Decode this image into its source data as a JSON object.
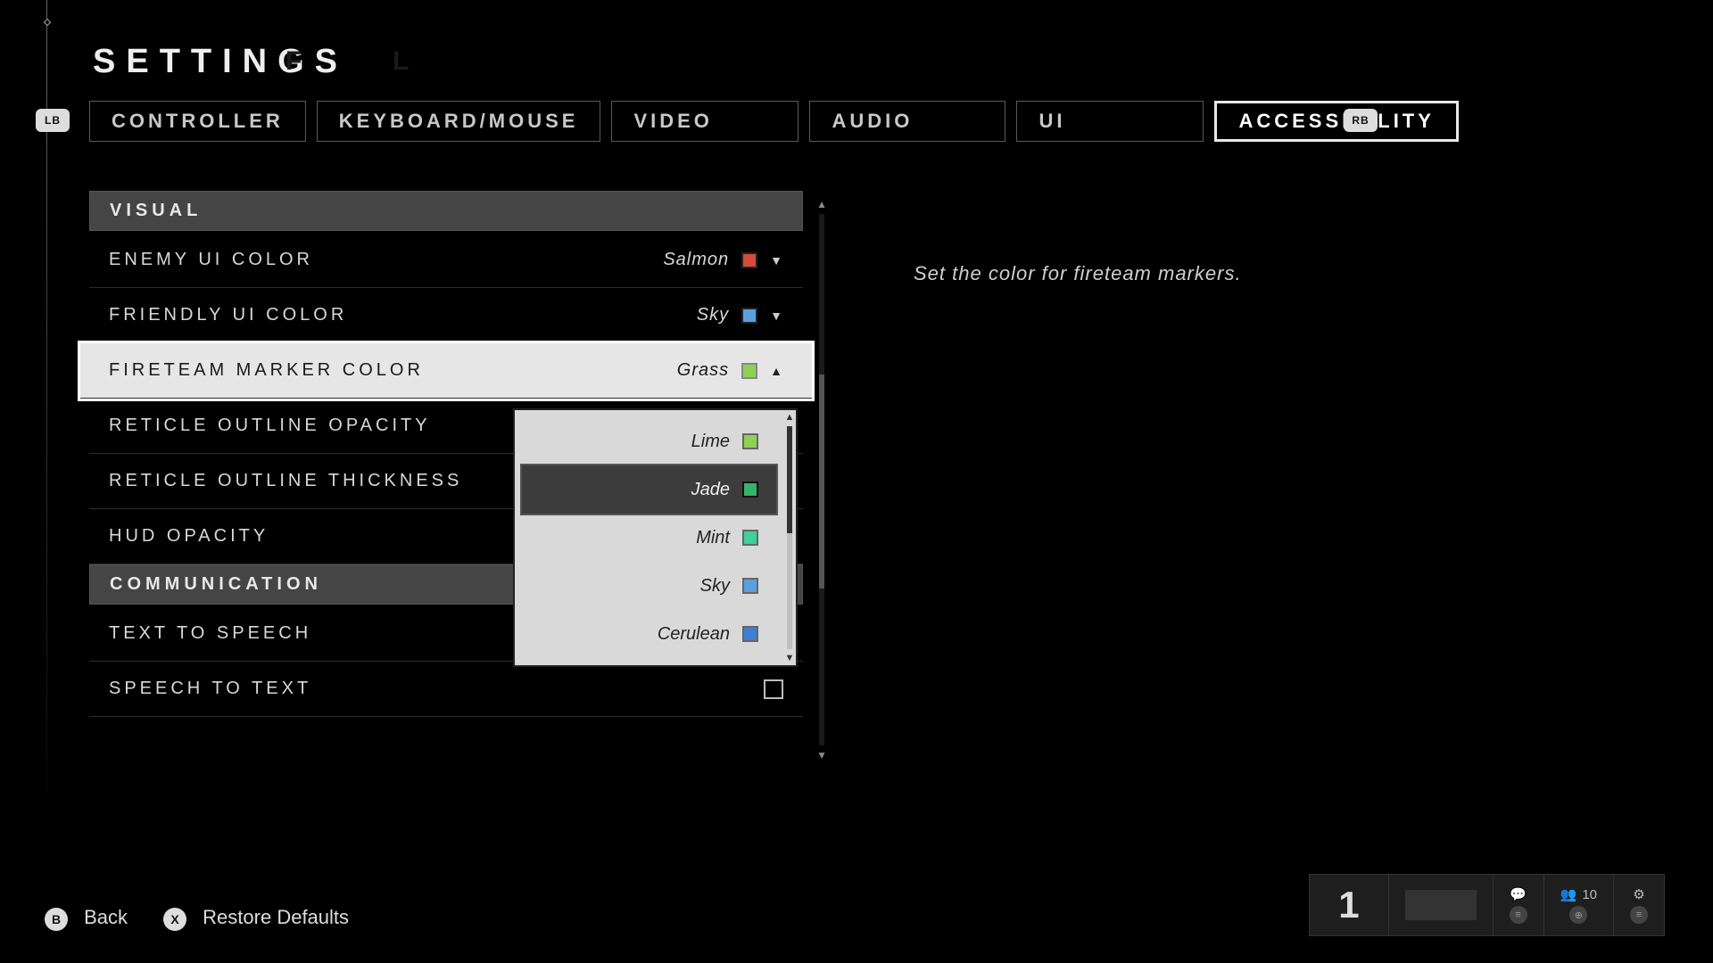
{
  "title": "SETTINGS",
  "tabs": [
    "CONTROLLER",
    "KEYBOARD/MOUSE",
    "VIDEO",
    "AUDIO",
    "UI",
    "ACCESSIBILITY"
  ],
  "active_tab_index": 5,
  "bumpers": {
    "left": "LB",
    "right": "RB"
  },
  "sections": {
    "visual_head": "VISUAL",
    "comm_head": "COMMUNICATION"
  },
  "rows": {
    "enemy": {
      "label": "ENEMY UI COLOR",
      "value": "Salmon",
      "swatch": "#d84a3a"
    },
    "friendly": {
      "label": "FRIENDLY UI COLOR",
      "value": "Sky",
      "swatch": "#5aa0e0"
    },
    "fireteam": {
      "label": "FIRETEAM MARKER COLOR",
      "value": "Grass",
      "swatch": "#8fd154"
    },
    "retopacity": {
      "label": "RETICLE OUTLINE OPACITY"
    },
    "retthick": {
      "label": "RETICLE OUTLINE THICKNESS"
    },
    "hud": {
      "label": "HUD OPACITY"
    },
    "tts": {
      "label": "TEXT TO SPEECH"
    },
    "stt": {
      "label": "SPEECH TO TEXT"
    }
  },
  "dropdown": {
    "items": [
      {
        "label": "Lime",
        "swatch": "#8fd154"
      },
      {
        "label": "Jade",
        "swatch": "#34b36a"
      },
      {
        "label": "Mint",
        "swatch": "#3fd19a"
      },
      {
        "label": "Sky",
        "swatch": "#5aa0e0"
      },
      {
        "label": "Cerulean",
        "swatch": "#3f7fd1"
      }
    ],
    "hover_index": 1
  },
  "description": "Set the color for fireteam markers.",
  "footer": {
    "back_key": "B",
    "back_label": "Back",
    "restore_key": "X",
    "restore_label": "Restore Defaults"
  },
  "br": {
    "big": "1",
    "party_count": "10"
  }
}
